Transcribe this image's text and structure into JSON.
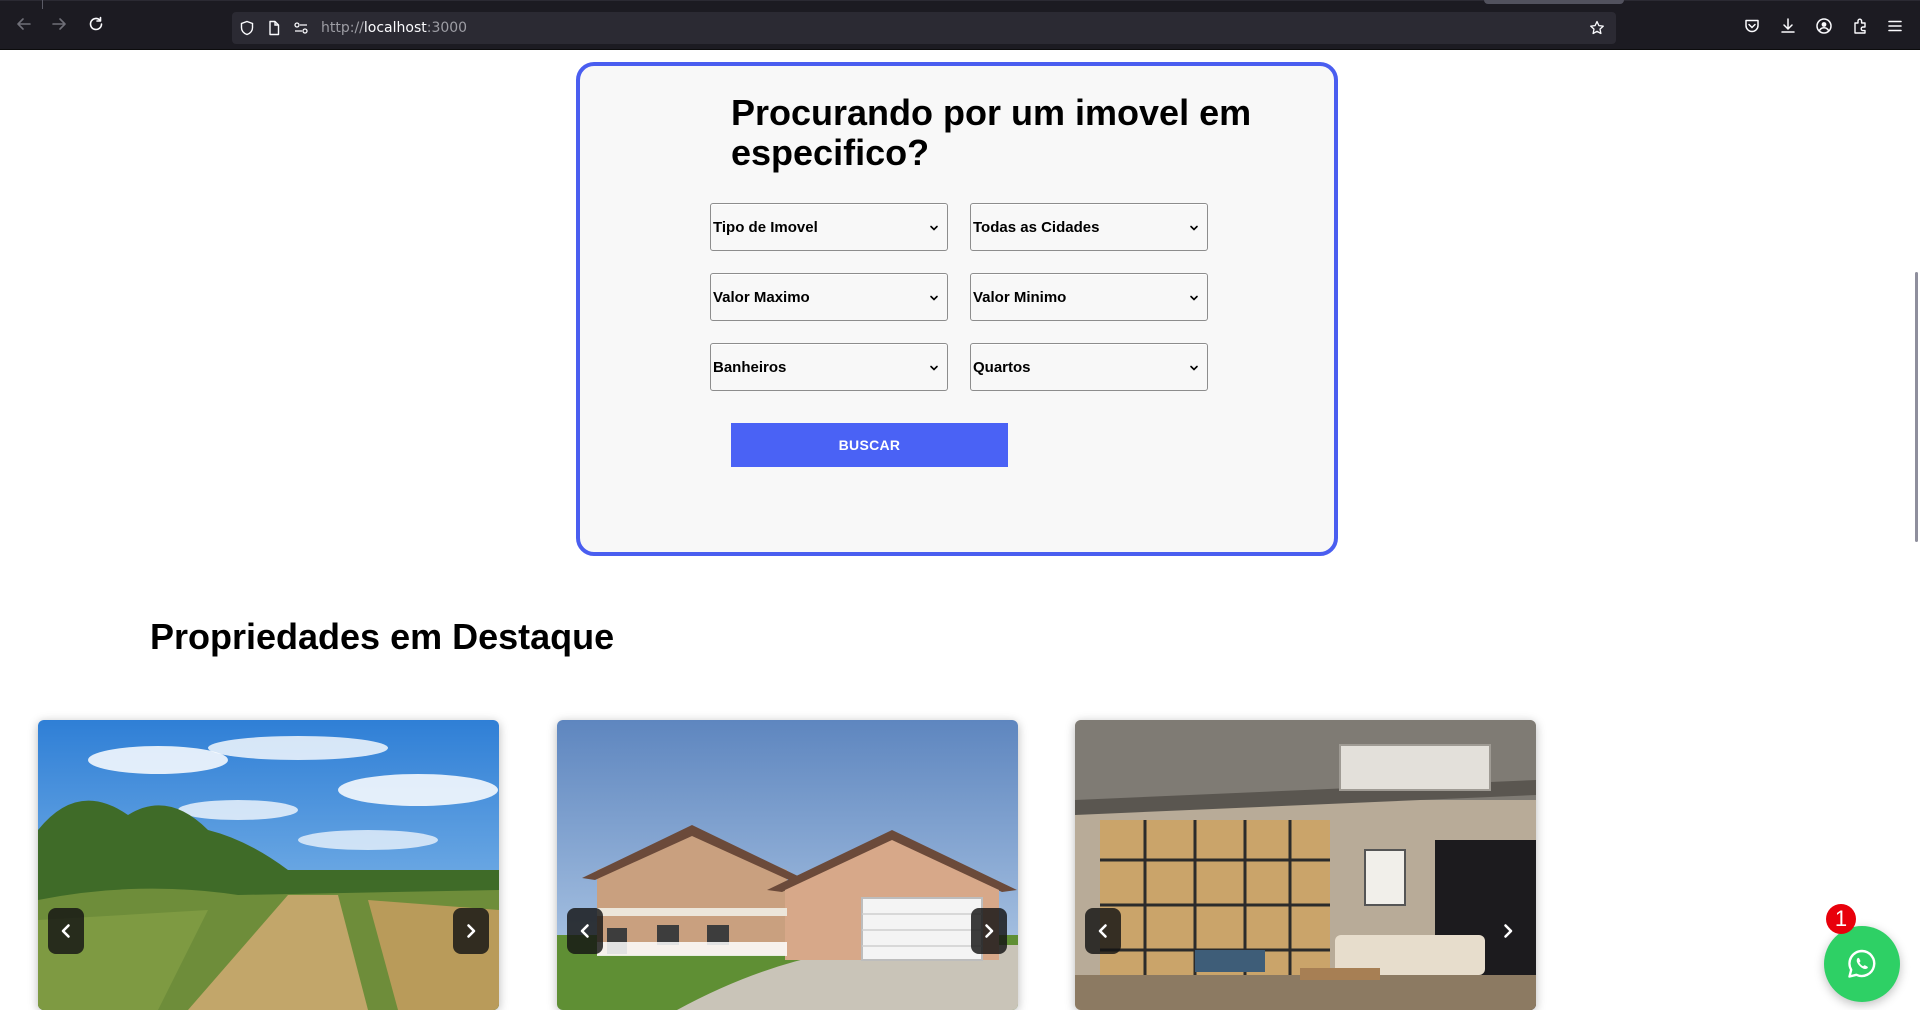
{
  "browser": {
    "url_prefix": "http://",
    "url_host": "localhost",
    "url_port": ":3000"
  },
  "search": {
    "title": "Procurando por um imovel em especifico?",
    "selects": [
      {
        "label": "Tipo de Imovel"
      },
      {
        "label": "Todas as Cidades"
      },
      {
        "label": "Valor Maximo"
      },
      {
        "label": "Valor Minimo"
      },
      {
        "label": "Banheiros"
      },
      {
        "label": "Quartos"
      }
    ],
    "button_label": "BUSCAR"
  },
  "featured": {
    "title": "Propriedades em Destaque",
    "cards": [
      {
        "image": "rural-land-photo"
      },
      {
        "image": "suburban-house-photo"
      },
      {
        "image": "modern-living-room-photo"
      }
    ]
  },
  "whatsapp": {
    "badge_count": "1",
    "color": "#2ed065"
  },
  "colors": {
    "accent": "#4a5ef0",
    "button": "#4a62f5",
    "browser_bg": "#1c1b22"
  }
}
